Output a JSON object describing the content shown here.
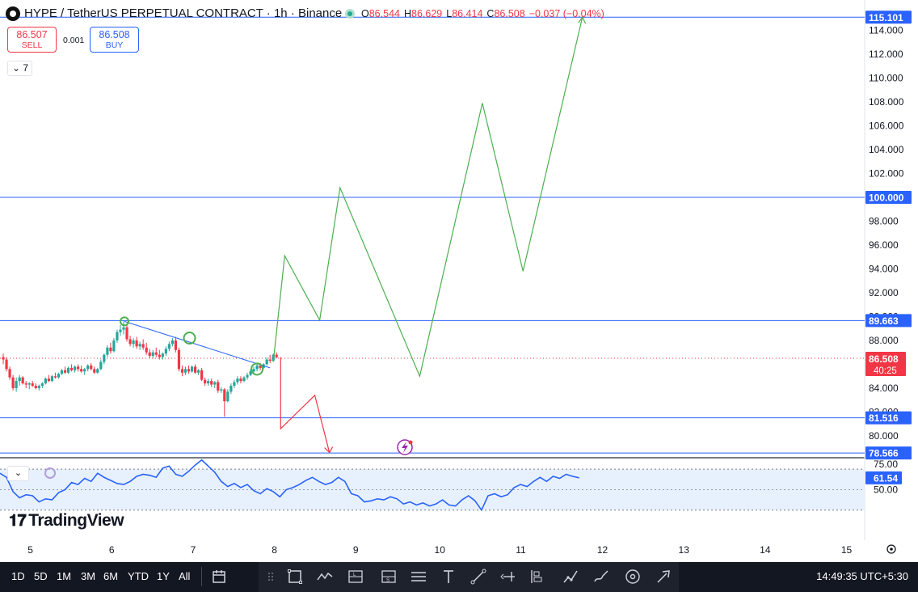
{
  "header": {
    "symbol_title": "HYPE / TetherUS PERPETUAL CONTRACT · 1h · Binance",
    "ohlc": {
      "o_label": "O",
      "o": "86.544",
      "h_label": "H",
      "h": "86.629",
      "l_label": "L",
      "l": "86.414",
      "c_label": "C",
      "c": "86.508",
      "change": "−0.037 (−0.04%)"
    }
  },
  "trade": {
    "sell_price": "86.507",
    "sell_label": "SELL",
    "spread": "0.001",
    "buy_price": "86.508",
    "buy_label": "BUY"
  },
  "indicators_count": "7",
  "logo": "TradingView",
  "colors": {
    "up": "#26a69a",
    "down": "#f23645",
    "accent": "#2962ff",
    "line_green": "#4caf50",
    "line_red": "#f23645",
    "rsi": "#2962ff"
  },
  "chart_data": {
    "type": "candlestick",
    "interval": "1h",
    "price_axis_ticks": [
      "114.000",
      "112.000",
      "110.000",
      "108.000",
      "106.000",
      "104.000",
      "102.000",
      "100.000",
      "98.000",
      "96.000",
      "94.000",
      "92.000",
      "90.000",
      "88.000",
      "86.000",
      "84.000",
      "82.000",
      "80.000"
    ],
    "price_range": [
      78.3,
      116.0
    ],
    "time_axis_ticks": [
      "5",
      "6",
      "7",
      "8",
      "9",
      "10",
      "11",
      "12",
      "13",
      "14",
      "15"
    ],
    "x_range": [
      4.62,
      15.25
    ],
    "candles_ohlc": [
      [
        4.66,
        86.6,
        86.9,
        86.0,
        86.4
      ],
      [
        4.7,
        86.4,
        86.6,
        85.4,
        85.6
      ],
      [
        4.74,
        85.6,
        85.8,
        84.7,
        84.9
      ],
      [
        4.78,
        84.9,
        85.1,
        83.8,
        84.0
      ],
      [
        4.82,
        84.0,
        84.9,
        83.7,
        84.6
      ],
      [
        4.86,
        84.6,
        85.1,
        84.2,
        84.9
      ],
      [
        4.9,
        84.9,
        85.0,
        84.3,
        84.4
      ],
      [
        4.94,
        84.4,
        84.6,
        84.0,
        84.3
      ],
      [
        4.98,
        84.3,
        84.5,
        83.9,
        84.4
      ],
      [
        5.02,
        84.4,
        84.6,
        84.1,
        84.2
      ],
      [
        5.06,
        84.2,
        84.4,
        83.9,
        84.0
      ],
      [
        5.1,
        84.0,
        84.3,
        83.8,
        84.2
      ],
      [
        5.14,
        84.2,
        84.5,
        84.0,
        84.4
      ],
      [
        5.18,
        84.4,
        84.9,
        84.3,
        84.8
      ],
      [
        5.22,
        84.8,
        85.1,
        84.5,
        84.6
      ],
      [
        5.26,
        84.6,
        85.1,
        84.5,
        85.0
      ],
      [
        5.3,
        85.0,
        85.3,
        84.8,
        84.9
      ],
      [
        5.34,
        84.9,
        85.3,
        84.8,
        85.2
      ],
      [
        5.38,
        85.2,
        85.6,
        85.1,
        85.5
      ],
      [
        5.42,
        85.5,
        85.8,
        85.2,
        85.3
      ],
      [
        5.46,
        85.3,
        85.8,
        85.2,
        85.7
      ],
      [
        5.5,
        85.7,
        86.0,
        85.4,
        85.5
      ],
      [
        5.54,
        85.5,
        85.9,
        85.3,
        85.8
      ],
      [
        5.58,
        85.8,
        86.0,
        85.4,
        85.6
      ],
      [
        5.62,
        85.6,
        85.9,
        85.3,
        85.4
      ],
      [
        5.66,
        85.4,
        85.7,
        85.1,
        85.6
      ],
      [
        5.7,
        85.6,
        86.0,
        85.4,
        85.9
      ],
      [
        5.74,
        85.9,
        86.1,
        85.5,
        85.6
      ],
      [
        5.78,
        85.6,
        85.8,
        85.2,
        85.3
      ],
      [
        5.82,
        85.3,
        85.7,
        85.2,
        85.6
      ],
      [
        5.86,
        85.6,
        86.4,
        85.5,
        86.2
      ],
      [
        5.9,
        86.2,
        86.9,
        86.0,
        86.8
      ],
      [
        5.94,
        86.8,
        87.6,
        86.6,
        87.4
      ],
      [
        5.98,
        87.4,
        87.8,
        86.9,
        87.1
      ],
      [
        6.02,
        87.1,
        88.2,
        87.0,
        88.0
      ],
      [
        6.06,
        88.0,
        88.9,
        87.8,
        88.7
      ],
      [
        6.1,
        88.7,
        89.3,
        88.4,
        88.9
      ],
      [
        6.14,
        88.9,
        89.6,
        88.5,
        89.1
      ],
      [
        6.18,
        89.1,
        89.4,
        87.9,
        88.1
      ],
      [
        6.22,
        88.1,
        88.4,
        87.5,
        87.7
      ],
      [
        6.26,
        87.7,
        88.2,
        87.4,
        88.0
      ],
      [
        6.3,
        88.0,
        88.3,
        87.3,
        87.5
      ],
      [
        6.34,
        87.5,
        87.9,
        87.2,
        87.7
      ],
      [
        6.38,
        87.7,
        88.1,
        87.2,
        87.4
      ],
      [
        6.42,
        87.4,
        87.8,
        86.8,
        87.0
      ],
      [
        6.46,
        87.0,
        87.3,
        86.5,
        86.7
      ],
      [
        6.5,
        86.7,
        87.2,
        86.5,
        87.0
      ],
      [
        6.54,
        87.0,
        87.4,
        86.6,
        86.8
      ],
      [
        6.58,
        86.8,
        87.2,
        86.4,
        86.6
      ],
      [
        6.62,
        86.6,
        87.0,
        86.4,
        86.9
      ],
      [
        6.66,
        86.9,
        87.5,
        86.7,
        87.3
      ],
      [
        6.7,
        87.3,
        87.9,
        87.1,
        87.7
      ],
      [
        6.74,
        87.7,
        88.2,
        87.5,
        88.0
      ],
      [
        6.78,
        88.0,
        88.3,
        87.0,
        87.2
      ],
      [
        6.82,
        87.2,
        87.4,
        85.4,
        85.6
      ],
      [
        6.86,
        85.6,
        85.9,
        85.0,
        85.3
      ],
      [
        6.9,
        85.3,
        85.8,
        85.1,
        85.6
      ],
      [
        6.94,
        85.6,
        85.9,
        85.2,
        85.4
      ],
      [
        6.98,
        85.4,
        85.9,
        85.3,
        85.8
      ],
      [
        7.02,
        85.8,
        86.0,
        85.2,
        85.3
      ],
      [
        7.06,
        85.3,
        85.6,
        85.1,
        85.5
      ],
      [
        7.1,
        85.5,
        85.7,
        84.6,
        84.7
      ],
      [
        7.14,
        84.7,
        84.9,
        84.2,
        84.4
      ],
      [
        7.18,
        84.4,
        84.8,
        84.2,
        84.6
      ],
      [
        7.22,
        84.6,
        84.8,
        84.1,
        84.3
      ],
      [
        7.26,
        84.3,
        84.6,
        84.0,
        84.5
      ],
      [
        7.3,
        84.5,
        84.7,
        83.6,
        83.8
      ],
      [
        7.34,
        83.8,
        84.1,
        83.6,
        83.9
      ],
      [
        7.38,
        83.9,
        84.0,
        81.6,
        82.9
      ],
      [
        7.42,
        82.9,
        83.9,
        82.8,
        83.7
      ],
      [
        7.46,
        83.7,
        84.4,
        83.5,
        84.2
      ],
      [
        7.5,
        84.2,
        84.7,
        84.0,
        84.5
      ],
      [
        7.54,
        84.5,
        85.0,
        84.3,
        84.8
      ],
      [
        7.58,
        84.8,
        85.0,
        84.4,
        84.6
      ],
      [
        7.62,
        84.6,
        85.0,
        84.5,
        84.9
      ],
      [
        7.66,
        84.9,
        85.3,
        84.7,
        85.1
      ],
      [
        7.7,
        85.1,
        85.6,
        85.0,
        85.4
      ],
      [
        7.74,
        85.4,
        85.8,
        85.2,
        85.6
      ],
      [
        7.78,
        85.6,
        86.0,
        85.4,
        85.9
      ],
      [
        7.82,
        85.9,
        86.1,
        85.5,
        85.7
      ],
      [
        7.86,
        85.7,
        86.1,
        85.6,
        86.0
      ],
      [
        7.9,
        86.0,
        86.6,
        85.9,
        86.4
      ],
      [
        7.94,
        86.4,
        86.8,
        86.1,
        86.3
      ],
      [
        7.98,
        86.3,
        86.9,
        86.2,
        86.8
      ],
      [
        8.02,
        86.8,
        87.0,
        86.5,
        86.6
      ]
    ],
    "horizontal_levels": [
      {
        "price": 115.101,
        "label": "115.101"
      },
      {
        "price": 100.0,
        "label": "100.000"
      },
      {
        "price": 89.663,
        "label": "89.663"
      },
      {
        "price": 81.516,
        "label": "81.516"
      },
      {
        "price": 78.566,
        "label": "78.566"
      }
    ],
    "current_price": {
      "price": 86.508,
      "label": "86.508",
      "countdown": "40:25"
    },
    "trendline": [
      [
        6.15,
        89.6
      ],
      [
        7.94,
        85.7
      ]
    ],
    "circle_markers": [
      [
        6.15,
        89.6
      ],
      [
        6.95,
        88.2
      ],
      [
        7.78,
        85.6
      ]
    ],
    "projection_up": [
      [
        7.98,
        86.2
      ],
      [
        8.12,
        95.1
      ],
      [
        8.55,
        89.7
      ],
      [
        8.8,
        100.8
      ],
      [
        9.78,
        85.0
      ],
      [
        10.55,
        107.9
      ],
      [
        11.05,
        93.8
      ],
      [
        11.78,
        115.1
      ]
    ],
    "projection_down": [
      [
        8.07,
        86.6
      ],
      [
        8.07,
        80.6
      ],
      [
        8.49,
        83.4
      ],
      [
        8.67,
        78.6
      ]
    ],
    "rsi": {
      "value_label": "61.54",
      "axis_ticks": [
        "75.00",
        "50.00"
      ],
      "band": [
        30,
        70
      ],
      "range": [
        10,
        78
      ],
      "values": [
        [
          4.62,
          66
        ],
        [
          4.7,
          62
        ],
        [
          4.78,
          48
        ],
        [
          4.86,
          42
        ],
        [
          4.94,
          45
        ],
        [
          5.02,
          44
        ],
        [
          5.1,
          38
        ],
        [
          5.18,
          41
        ],
        [
          5.26,
          40
        ],
        [
          5.34,
          47
        ],
        [
          5.42,
          50
        ],
        [
          5.5,
          57
        ],
        [
          5.58,
          55
        ],
        [
          5.66,
          61
        ],
        [
          5.74,
          58
        ],
        [
          5.82,
          66
        ],
        [
          5.9,
          62
        ],
        [
          5.98,
          59
        ],
        [
          6.06,
          56
        ],
        [
          6.14,
          55
        ],
        [
          6.22,
          58
        ],
        [
          6.3,
          63
        ],
        [
          6.38,
          65
        ],
        [
          6.46,
          64
        ],
        [
          6.54,
          62
        ],
        [
          6.62,
          71
        ],
        [
          6.7,
          73
        ],
        [
          6.78,
          65
        ],
        [
          6.86,
          63
        ],
        [
          6.94,
          68
        ],
        [
          7.02,
          74
        ],
        [
          7.1,
          79
        ],
        [
          7.18,
          73
        ],
        [
          7.26,
          67
        ],
        [
          7.34,
          58
        ],
        [
          7.42,
          53
        ],
        [
          7.5,
          56
        ],
        [
          7.58,
          52
        ],
        [
          7.66,
          55
        ],
        [
          7.74,
          49
        ],
        [
          7.82,
          46
        ],
        [
          7.9,
          51
        ],
        [
          7.98,
          48
        ],
        [
          8.06,
          43
        ],
        [
          8.14,
          50
        ],
        [
          8.22,
          52
        ],
        [
          8.3,
          55
        ],
        [
          8.38,
          59
        ],
        [
          8.46,
          62
        ],
        [
          8.54,
          58
        ],
        [
          8.62,
          55
        ],
        [
          8.7,
          57
        ],
        [
          8.78,
          62
        ],
        [
          8.86,
          58
        ],
        [
          8.94,
          46
        ],
        [
          9.02,
          44
        ],
        [
          9.1,
          38
        ],
        [
          9.18,
          39
        ],
        [
          9.26,
          41
        ],
        [
          9.34,
          40
        ],
        [
          9.42,
          43
        ],
        [
          9.5,
          41
        ],
        [
          9.58,
          36
        ],
        [
          9.66,
          38
        ],
        [
          9.74,
          35
        ],
        [
          9.82,
          37
        ],
        [
          9.9,
          34
        ],
        [
          9.98,
          36
        ],
        [
          10.06,
          40
        ],
        [
          10.14,
          35
        ],
        [
          10.22,
          34
        ],
        [
          10.3,
          40
        ],
        [
          10.38,
          44
        ],
        [
          10.46,
          39
        ],
        [
          10.54,
          30
        ],
        [
          10.62,
          44
        ],
        [
          10.7,
          46
        ],
        [
          10.78,
          43
        ],
        [
          10.86,
          45
        ],
        [
          10.94,
          52
        ],
        [
          11.02,
          55
        ],
        [
          11.1,
          53
        ],
        [
          11.18,
          58
        ],
        [
          11.26,
          62
        ],
        [
          11.34,
          58
        ],
        [
          11.42,
          63
        ],
        [
          11.5,
          61
        ],
        [
          11.58,
          65
        ],
        [
          11.66,
          63
        ],
        [
          11.74,
          61.54
        ]
      ]
    }
  },
  "timeframes": [
    "1D",
    "5D",
    "1M",
    "3M",
    "6M",
    "YTD",
    "1Y",
    "All"
  ],
  "clock": "14:49:35 UTC+5:30"
}
